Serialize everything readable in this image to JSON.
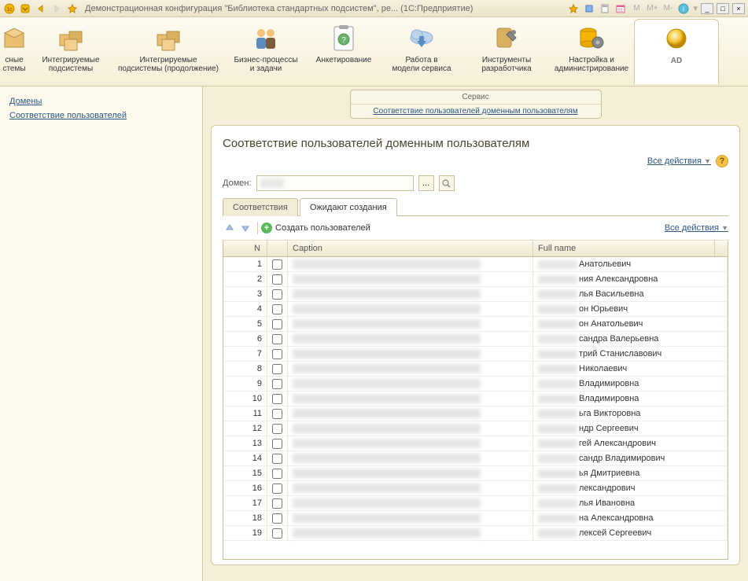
{
  "title_bar": {
    "title": "Демонстрационная конфигурация \"Библиотека стандартных подсистем\", ре...  (1С:Предприятие)",
    "m_labels": [
      "M",
      "M+",
      "M-"
    ]
  },
  "sections": [
    {
      "label": "сные\nстемы"
    },
    {
      "label": "Интегрируемые\nподсистемы"
    },
    {
      "label": "Интегрируемые\nподсистемы (продолжение)"
    },
    {
      "label": "Бизнес-процессы\nи задачи"
    },
    {
      "label": "Анкетирование"
    },
    {
      "label": "Работа в\nмодели сервиса"
    },
    {
      "label": "Инструменты\nразработчика"
    },
    {
      "label": "Настройка и\nадминистрирование"
    },
    {
      "label": "AD",
      "active": true
    }
  ],
  "nav": {
    "items": [
      "Домены",
      "Соответствие пользователей"
    ]
  },
  "breadcrumb": {
    "top": "Сервис",
    "bottom": "Соответствие пользователей доменным пользователям"
  },
  "page": {
    "title": "Соответствие пользователей доменным пользователям",
    "all_actions": "Все действия",
    "domain_label": "Домен:"
  },
  "tabs": [
    {
      "label": "Соответствия",
      "active": false
    },
    {
      "label": "Ожидают создания",
      "active": true
    }
  ],
  "toolbar": {
    "create_users": "Создать пользователей",
    "all_actions": "Все действия"
  },
  "grid": {
    "headers": {
      "n": "N",
      "caption": "Caption",
      "full_name": "Full name"
    },
    "rows": [
      {
        "n": 1,
        "suffix": " Анатольевич"
      },
      {
        "n": 2,
        "suffix": "ния Александровна"
      },
      {
        "n": 3,
        "suffix": "лья Васильевна"
      },
      {
        "n": 4,
        "suffix": "он Юрьевич"
      },
      {
        "n": 5,
        "suffix": "он Анатольевич"
      },
      {
        "n": 6,
        "suffix": "сандра Валерьевна"
      },
      {
        "n": 7,
        "suffix": "трий Станиславович"
      },
      {
        "n": 8,
        "suffix": " Николаевич"
      },
      {
        "n": 9,
        "suffix": " Владимировна"
      },
      {
        "n": 10,
        "suffix": " Владимировна"
      },
      {
        "n": 11,
        "suffix": "ьга Викторовна"
      },
      {
        "n": 12,
        "suffix": "ндр Сергеевич"
      },
      {
        "n": 13,
        "suffix": "гей Александрович"
      },
      {
        "n": 14,
        "suffix": "сандр Владимирович"
      },
      {
        "n": 15,
        "suffix": "ья Дмитриевна"
      },
      {
        "n": 16,
        "suffix": "лександрович"
      },
      {
        "n": 17,
        "suffix": "лья Ивановна"
      },
      {
        "n": 18,
        "suffix": "на Александровна"
      },
      {
        "n": 19,
        "suffix": "лексей Сергеевич"
      }
    ]
  }
}
